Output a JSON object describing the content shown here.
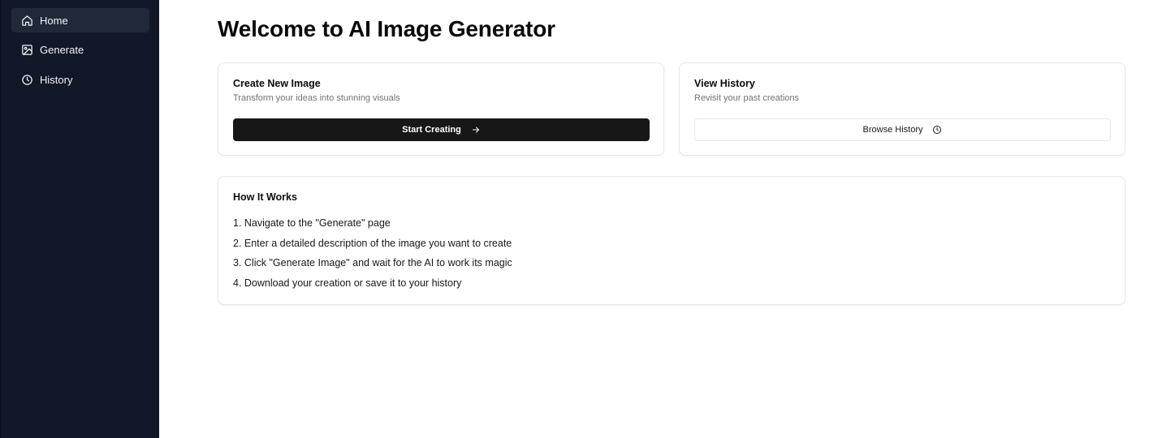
{
  "sidebar": {
    "items": [
      {
        "label": "Home",
        "icon": "home-icon",
        "active": true
      },
      {
        "label": "Generate",
        "icon": "image-icon",
        "active": false
      },
      {
        "label": "History",
        "icon": "clock-icon",
        "active": false
      }
    ]
  },
  "main": {
    "title": "Welcome to AI Image Generator",
    "cards": [
      {
        "title": "Create New Image",
        "description": "Transform your ideas into stunning visuals",
        "button_label": "Start Creating",
        "button_icon": "arrow-right-icon"
      },
      {
        "title": "View History",
        "description": "Revisit your past creations",
        "button_label": "Browse History",
        "button_icon": "clock-icon"
      }
    ],
    "how_it_works": {
      "title": "How It Works",
      "steps": [
        "1. Navigate to the \"Generate\" page",
        "2. Enter a detailed description of the image you want to create",
        "3. Click \"Generate Image\" and wait for the AI to work its magic",
        "4. Download your creation or save it to your history"
      ]
    }
  },
  "colors": {
    "sidebar_bg": "#111827",
    "sidebar_active": "#1f2937",
    "primary_button": "#171717",
    "card_border": "#e5e7eb",
    "muted_text": "#737373"
  }
}
